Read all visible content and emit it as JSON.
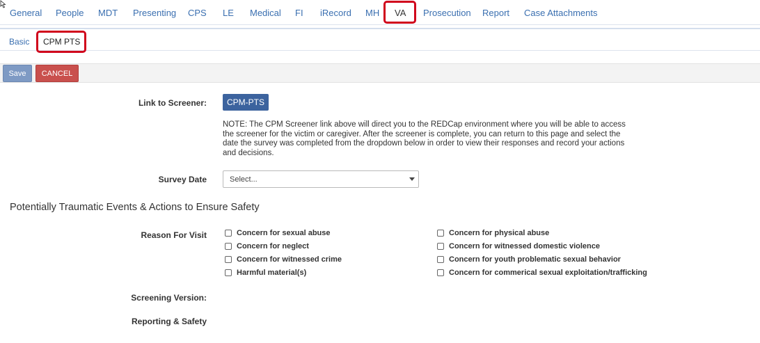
{
  "top_tabs": {
    "items": [
      {
        "label": "General"
      },
      {
        "label": "People"
      },
      {
        "label": "MDT"
      },
      {
        "label": "Presenting"
      },
      {
        "label": "CPS"
      },
      {
        "label": "LE"
      },
      {
        "label": "Medical"
      },
      {
        "label": "FI"
      },
      {
        "label": "iRecord"
      },
      {
        "label": "MH"
      },
      {
        "label": "VA"
      },
      {
        "label": "Prosecution"
      },
      {
        "label": "Report"
      },
      {
        "label": "Case Attachments"
      }
    ],
    "active": "VA"
  },
  "sub_tabs": {
    "items": [
      {
        "label": "Basic"
      },
      {
        "label": "CPM PTS"
      }
    ],
    "active": "CPM PTS"
  },
  "toolbar": {
    "save_label": "Save",
    "cancel_label": "CANCEL"
  },
  "screener": {
    "label": "Link to Screener:",
    "button_label": "CPM-PTS",
    "note": "NOTE: The CPM Screener link above will direct you to the REDCap environment where you will be able to access the screener for the victim or caregiver. After the screener is complete, you can return to this page and select the date the survey was completed from the dropdown below in order to view their responses and record your actions and decisions."
  },
  "survey_date": {
    "label": "Survey Date",
    "value": "Select..."
  },
  "section": {
    "title": "Potentially Traumatic Events & Actions to Ensure Safety"
  },
  "reason_for_visit": {
    "label": "Reason For Visit",
    "left_options": [
      {
        "label": "Concern for sexual abuse",
        "checked": false
      },
      {
        "label": "Concern for neglect",
        "checked": false
      },
      {
        "label": "Concern for witnessed crime",
        "checked": false
      },
      {
        "label": "Harmful material(s)",
        "checked": false
      }
    ],
    "right_options": [
      {
        "label": "Concern for physical abuse",
        "checked": false
      },
      {
        "label": "Concern for witnessed domestic violence",
        "checked": false
      },
      {
        "label": "Concern for youth problematic sexual behavior",
        "checked": false
      },
      {
        "label": "Concern for commerical sexual exploitation/trafficking",
        "checked": false
      }
    ]
  },
  "screening_version": {
    "label": "Screening Version:"
  },
  "reporting_safety": {
    "label": "Reporting & Safety"
  },
  "colors": {
    "link": "#3a6fb0",
    "highlight": "#d0021b",
    "save": "#7e9ac4",
    "cancel": "#c9504d",
    "primary": "#3c639e"
  }
}
